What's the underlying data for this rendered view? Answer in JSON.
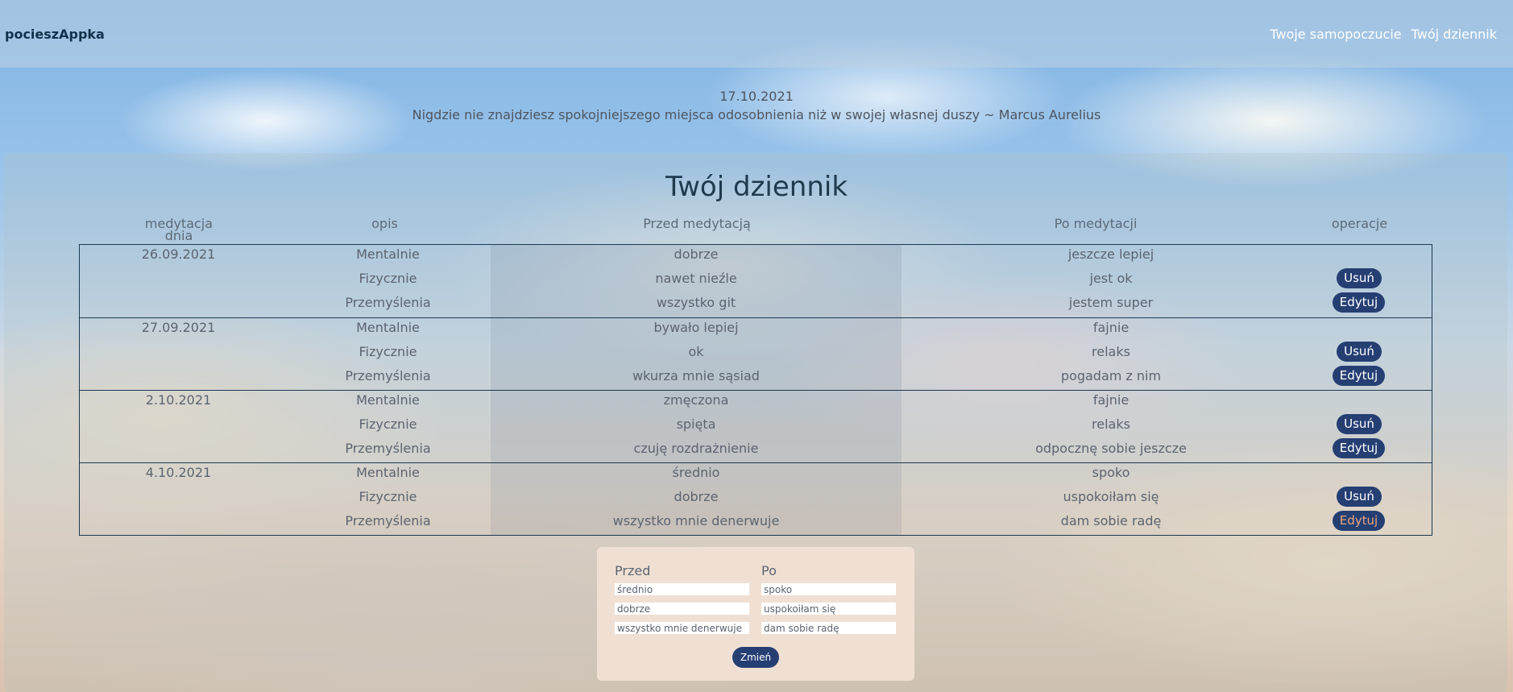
{
  "header": {
    "brand": "pocieszAppka",
    "nav": [
      "Twoje samopoczucie",
      "Twój dziennik"
    ]
  },
  "quote": {
    "date": "17.10.2021",
    "text": "Nigdzie nie znajdziesz spokojniejszego miejsca odosobnienia niż w swojej własnej duszy ~ Marcus Aurelius"
  },
  "diary": {
    "title": "Twój dziennik",
    "columns": {
      "date": "medytacja dnia",
      "desc": "opis",
      "before": "Przed medytacją",
      "after": "Po medytacji",
      "ops": "operacje"
    },
    "delete_label": "Usuń",
    "edit_label": "Edytuj",
    "entries": [
      {
        "date": "26.09.2021",
        "rows": [
          {
            "desc": "Mentalnie",
            "before": "dobrze",
            "after": "jeszcze lepiej"
          },
          {
            "desc": "Fizycznie",
            "before": "nawet nieźle",
            "after": "jest ok"
          },
          {
            "desc": "Przemyślenia",
            "before": "wszystko git",
            "after": "jestem super"
          }
        ]
      },
      {
        "date": "27.09.2021",
        "rows": [
          {
            "desc": "Mentalnie",
            "before": "bywało lepiej",
            "after": "fajnie"
          },
          {
            "desc": "Fizycznie",
            "before": "ok",
            "after": "relaks"
          },
          {
            "desc": "Przemyślenia",
            "before": "wkurza mnie sąsiad",
            "after": "pogadam z nim"
          }
        ]
      },
      {
        "date": "2.10.2021",
        "rows": [
          {
            "desc": "Mentalnie",
            "before": "zmęczona",
            "after": "fajnie"
          },
          {
            "desc": "Fizycznie",
            "before": "spięta",
            "after": "relaks"
          },
          {
            "desc": "Przemyślenia",
            "before": "czuję rozdrażnienie",
            "after": "odpocznę sobie jeszcze"
          }
        ]
      },
      {
        "date": "4.10.2021",
        "rows": [
          {
            "desc": "Mentalnie",
            "before": "średnio",
            "after": "spoko"
          },
          {
            "desc": "Fizycznie",
            "before": "dobrze",
            "after": "uspokoiłam się"
          },
          {
            "desc": "Przemyślenia",
            "before": "wszystko mnie denerwuje",
            "after": "dam sobie radę"
          }
        ]
      }
    ]
  },
  "edit_form": {
    "before_label": "Przed",
    "after_label": "Po",
    "before_values": [
      "średnio",
      "dobrze",
      "wszystko mnie denerwuje"
    ],
    "after_values": [
      "spoko",
      "uspokoiłam się",
      "dam sobie radę"
    ],
    "submit_label": "Zmień"
  },
  "colors": {
    "button": "#253f73",
    "active_edit_text": "#e9a57f",
    "table_border": "#1b3a52",
    "form_bg": "#f0e0d4"
  }
}
